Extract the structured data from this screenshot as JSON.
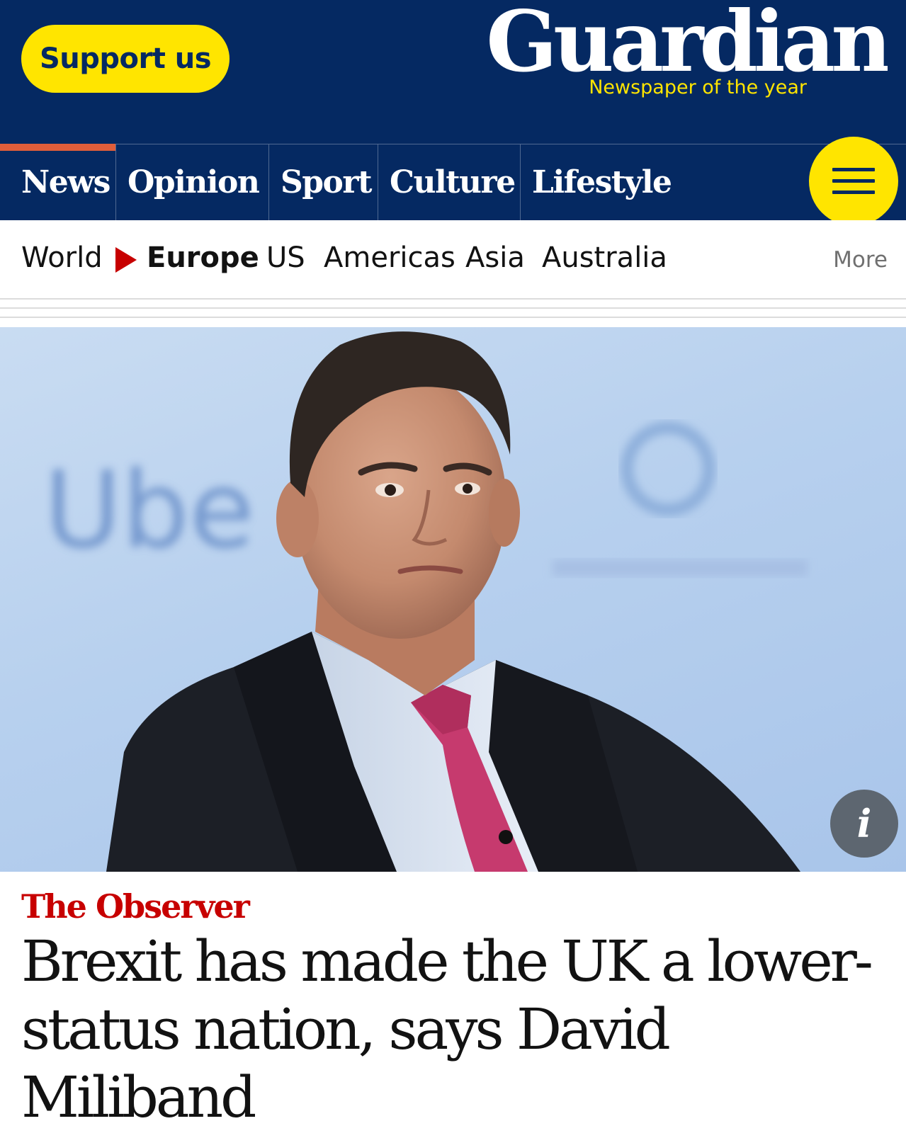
{
  "header": {
    "support_label": "Support us",
    "logo_text": "Guardian",
    "logo_subtitle": "Newspaper of the year"
  },
  "pillars": {
    "items": [
      {
        "label": "News",
        "active": true
      },
      {
        "label": "Opinion"
      },
      {
        "label": "Sport"
      },
      {
        "label": "Culture"
      },
      {
        "label": "Lifestyle"
      }
    ],
    "menu_icon": "hamburger-menu-icon"
  },
  "subnav": {
    "items": [
      "World",
      "Europe",
      "US",
      "Americas",
      "Asia",
      "Australia"
    ],
    "current": "Europe",
    "more_label": "More"
  },
  "hero": {
    "backdrop_text": "Ube",
    "info_label": "i"
  },
  "article": {
    "kicker": "The Observer",
    "headline": "Brexit has made the UK a lower-status nation, says David Miliband"
  },
  "colors": {
    "brand_blue": "#052962",
    "brand_yellow": "#ffe500",
    "news_red": "#c70000"
  }
}
